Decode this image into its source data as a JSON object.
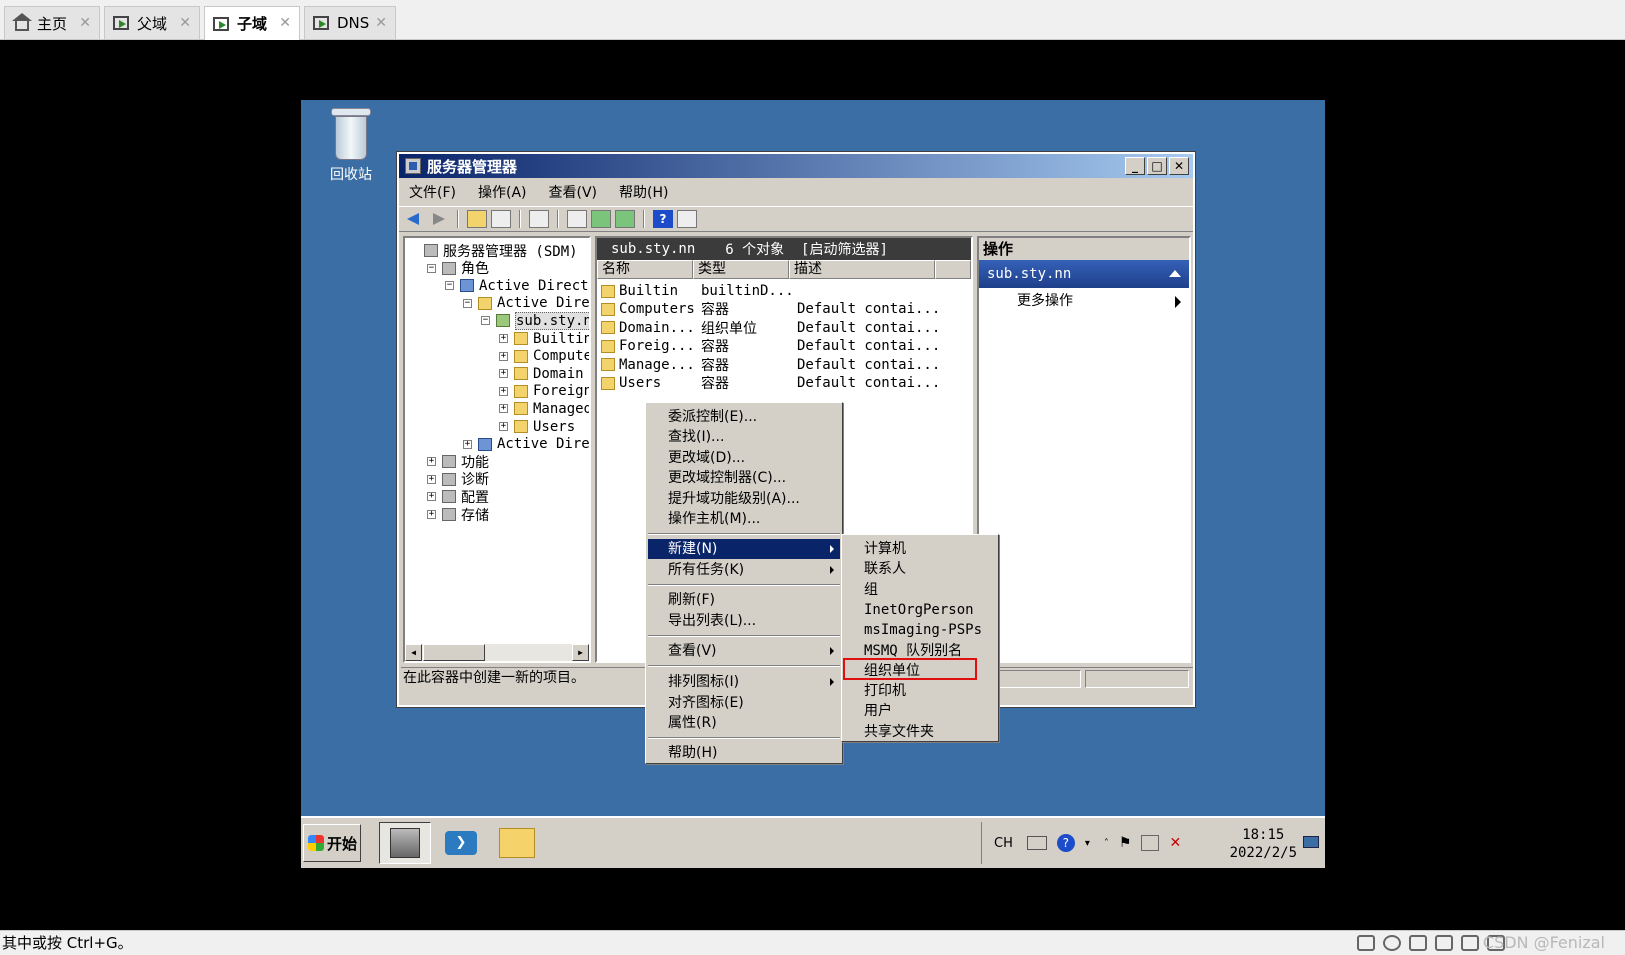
{
  "host_tabs": [
    {
      "label": "主页",
      "icon": "home-icon"
    },
    {
      "label": "父域",
      "icon": "vm-icon"
    },
    {
      "label": "子域",
      "icon": "vm-icon",
      "active": true
    },
    {
      "label": "DNS",
      "icon": "vm-icon"
    }
  ],
  "desktop": {
    "recycle_bin_label": "回收站"
  },
  "window": {
    "title": "服务器管理器",
    "menu": [
      "文件(F)",
      "操作(A)",
      "查看(V)",
      "帮助(H)"
    ],
    "status_text": "在此容器中创建一新的项目。"
  },
  "tree": [
    {
      "label": "服务器管理器 (SDM)",
      "level": 0,
      "exp": "",
      "icon": "gray"
    },
    {
      "label": "角色",
      "level": 1,
      "exp": "−",
      "icon": "gray"
    },
    {
      "label": "Active Directory",
      "level": 2,
      "exp": "−",
      "icon": "blue"
    },
    {
      "label": "Active Directo",
      "level": 3,
      "exp": "−",
      "icon": "folder"
    },
    {
      "label": "sub.sty.nn",
      "level": 4,
      "exp": "−",
      "icon": "green",
      "selected": true
    },
    {
      "label": "Builtin",
      "level": 5,
      "exp": "+",
      "icon": "folder"
    },
    {
      "label": "Computers",
      "level": 5,
      "exp": "+",
      "icon": "folder"
    },
    {
      "label": "Domain Co",
      "level": 5,
      "exp": "+",
      "icon": "folder"
    },
    {
      "label": "ForeignSe",
      "level": 5,
      "exp": "+",
      "icon": "folder"
    },
    {
      "label": "Managed S",
      "level": 5,
      "exp": "+",
      "icon": "folder"
    },
    {
      "label": "Users",
      "level": 5,
      "exp": "+",
      "icon": "folder"
    },
    {
      "label": "Active Directo",
      "level": 3,
      "exp": "+",
      "icon": "blue"
    },
    {
      "label": "功能",
      "level": 1,
      "exp": "+",
      "icon": "gray"
    },
    {
      "label": "诊断",
      "level": 1,
      "exp": "+",
      "icon": "gray"
    },
    {
      "label": "配置",
      "level": 1,
      "exp": "+",
      "icon": "gray"
    },
    {
      "label": "存储",
      "level": 1,
      "exp": "+",
      "icon": "gray"
    }
  ],
  "list": {
    "header_path": "sub.sty.nn",
    "header_count": "6 个对象",
    "header_filter": "[启动筛选器]",
    "columns": [
      "名称",
      "类型",
      "描述"
    ],
    "rows": [
      [
        "Builtin",
        "builtinD...",
        ""
      ],
      [
        "Computers",
        "容器",
        "Default contai..."
      ],
      [
        "Domain...",
        "组织单位",
        "Default contai..."
      ],
      [
        "Foreig...",
        "容器",
        "Default contai..."
      ],
      [
        "Manage...",
        "容器",
        "Default contai..."
      ],
      [
        "Users",
        "容器",
        "Default contai..."
      ]
    ]
  },
  "actions": {
    "header": "操作",
    "selected": "sub.sty.nn",
    "more": "更多操作"
  },
  "context_menu": [
    "委派控制(E)...",
    "查找(I)...",
    "更改域(D)...",
    "更改域控制器(C)...",
    "提升域功能级别(A)...",
    "操作主机(M)...",
    "新建(N)",
    "所有任务(K)",
    "刷新(F)",
    "导出列表(L)...",
    "查看(V)",
    "排列图标(I)",
    "对齐图标(E)",
    "属性(R)",
    "帮助(H)"
  ],
  "submenu_new": [
    "计算机",
    "联系人",
    "组",
    "InetOrgPerson",
    "msImaging-PSPs",
    "MSMQ 队列别名",
    "组织单位",
    "打印机",
    "用户",
    "共享文件夹"
  ],
  "taskbar": {
    "start_label": "开始",
    "lang": "CH",
    "time": "18:15",
    "date": "2022/2/5"
  },
  "host_status": {
    "text": "其中或按 Ctrl+G。",
    "watermark": "CSDN @Fenizal"
  }
}
